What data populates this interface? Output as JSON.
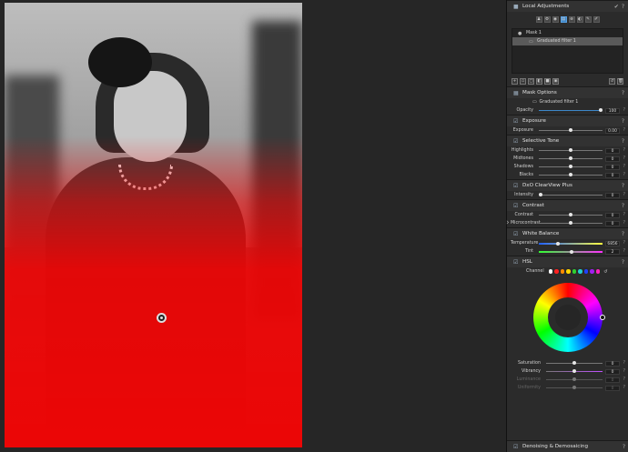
{
  "panel": {
    "local_adjustments": {
      "title": "Local Adjustments"
    },
    "masks": [
      {
        "label": "Mask 1"
      },
      {
        "label": "Graduated filter 1"
      }
    ],
    "mask_options": {
      "title": "Mask Options",
      "filter_name": "Graduated filter 1",
      "opacity_label": "Opacity",
      "opacity_value": "100",
      "opacity_fraction": 1.0
    },
    "exposure": {
      "title": "Exposure",
      "label": "Exposure",
      "value": "0.00"
    },
    "selective_tone": {
      "title": "Selective Tone",
      "rows": [
        {
          "label": "Highlights",
          "value": "0"
        },
        {
          "label": "Midtones",
          "value": "0"
        },
        {
          "label": "Shadows",
          "value": "0"
        },
        {
          "label": "Blacks",
          "value": "0"
        }
      ]
    },
    "clearview": {
      "title": "DxO ClearView Plus",
      "label": "Intensity",
      "value": "0"
    },
    "contrast": {
      "title": "Contrast",
      "rows": [
        {
          "label": "Contrast",
          "value": "0"
        },
        {
          "label": "Microcontrast",
          "value": "0"
        }
      ]
    },
    "white_balance": {
      "title": "White Balance",
      "temp_label": "Temperature",
      "temp_value": "6856",
      "tint_label": "Tint",
      "tint_value": "2"
    },
    "hsl": {
      "title": "HSL",
      "channel_label": "Channel",
      "channel_colors": [
        "#ffffff",
        "#ff2020",
        "#ff8c00",
        "#ffd800",
        "#30d030",
        "#20d0d0",
        "#2040ff",
        "#a020f0",
        "#ff20c0"
      ],
      "rows": [
        {
          "label": "Saturation",
          "value": "0"
        },
        {
          "label": "Vibrancy",
          "value": "0"
        },
        {
          "label": "Luminance",
          "value": "0"
        },
        {
          "label": "Uniformity",
          "value": "0"
        }
      ]
    },
    "demosaicing": {
      "title": "Denoising & Demosaicing"
    }
  },
  "colors": {
    "accent": "#3d87c9",
    "mask_red": "#ff0000",
    "panel_bg": "#2b2b2b"
  }
}
